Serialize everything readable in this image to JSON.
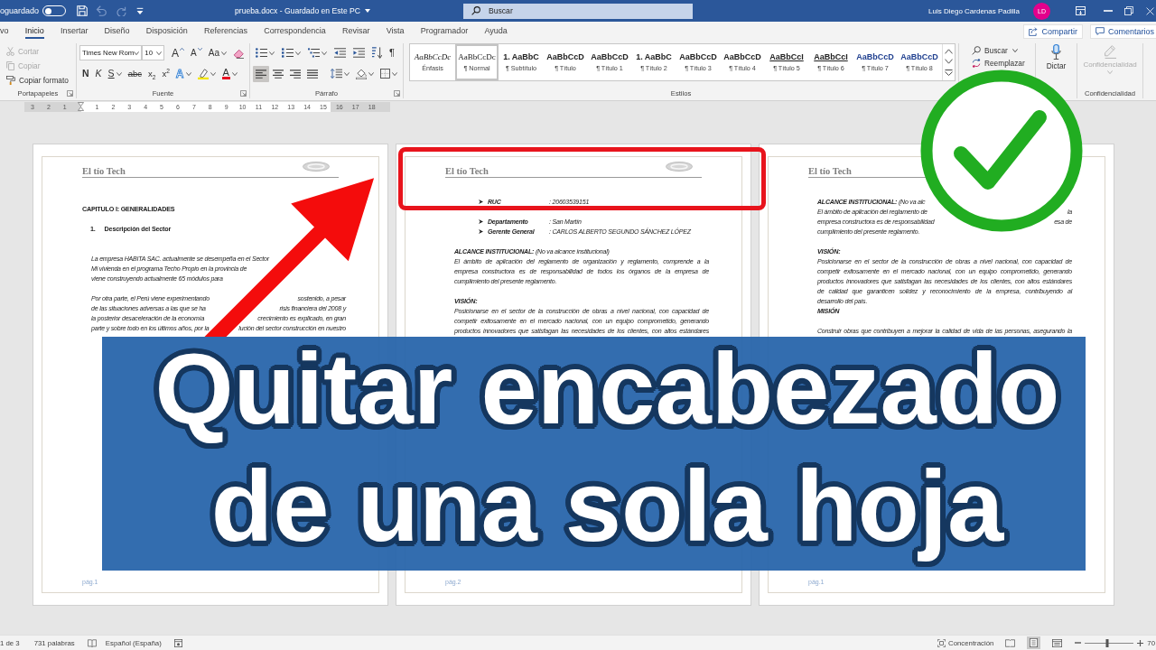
{
  "title_bar": {
    "autosave_label": "oguardado",
    "autosave_on": false,
    "quick_access": [
      {
        "kind": "save",
        "disabled": false
      },
      {
        "kind": "undo",
        "disabled": true
      },
      {
        "kind": "redo",
        "disabled": true
      },
      {
        "kind": "customize",
        "disabled": false
      }
    ],
    "document_title": "prueba.docx - Guardado en Este PC",
    "search": {
      "placeholder": "Buscar"
    },
    "user_name": "Luis Diego Cardenas Padilla",
    "avatar_initials": "LD"
  },
  "tabs": [
    {
      "label": "vo",
      "selected": false
    },
    {
      "label": "Inicio",
      "selected": true
    },
    {
      "label": "Insertar",
      "selected": false
    },
    {
      "label": "Diseño",
      "selected": false
    },
    {
      "label": "Disposición",
      "selected": false
    },
    {
      "label": "Referencias",
      "selected": false
    },
    {
      "label": "Correspondencia",
      "selected": false
    },
    {
      "label": "Revisar",
      "selected": false
    },
    {
      "label": "Vista",
      "selected": false
    },
    {
      "label": "Programador",
      "selected": false
    },
    {
      "label": "Ayuda",
      "selected": false
    }
  ],
  "share_button": {
    "label": "Compartir"
  },
  "comments_button": {
    "label": "Comentarios"
  },
  "ribbon": [
    {
      "kind": "clipboard",
      "label": "Portapapeles",
      "commands": [
        {
          "kind": "cut",
          "label": "Cortar",
          "disabled": true
        },
        {
          "kind": "copy",
          "label": "Copiar",
          "disabled": true
        },
        {
          "kind": "format_painter",
          "label": "Copiar formato",
          "disabled": false
        }
      ]
    },
    {
      "kind": "font",
      "label": "Fuente",
      "font_name": "Times New Rom",
      "font_size": "10",
      "top_tools": [
        {
          "kind": "grow",
          "text": "A"
        },
        {
          "kind": "shrink",
          "text": "A"
        },
        {
          "kind": "case",
          "text": "Aa",
          "menu": true
        },
        {
          "kind": "clear"
        }
      ],
      "bottom_tools": [
        {
          "kind": "bold",
          "text": "N"
        },
        {
          "kind": "italic",
          "text": "K"
        },
        {
          "kind": "underline",
          "text": "S",
          "menu": true
        },
        {
          "kind": "strike",
          "text": "abc"
        },
        {
          "kind": "subscript",
          "text": "x$_{2}$"
        },
        {
          "kind": "superscript",
          "text": "x$^{2}$"
        },
        {
          "kind": "effects",
          "text": "A",
          "menu": true
        },
        {
          "kind": "highlight",
          "menu": true
        },
        {
          "kind": "font_color",
          "text": "A",
          "menu": true
        }
      ]
    },
    {
      "kind": "paragraph",
      "label": "Párrafo",
      "top_tools": [
        {
          "kind": "bullets",
          "menu": true
        },
        {
          "kind": "numbering",
          "menu": true
        },
        {
          "kind": "multilevel",
          "menu": true
        },
        {
          "kind": "outdent"
        },
        {
          "kind": "indent"
        },
        {
          "kind": "sort"
        },
        {
          "kind": "marks",
          "text": "¶"
        }
      ],
      "alignment": [
        {
          "kind": "align_left",
          "selected": true
        },
        {
          "kind": "align_center",
          "selected": false
        },
        {
          "kind": "align_right",
          "selected": false
        },
        {
          "kind": "justify",
          "selected": false
        }
      ],
      "bottom_tools": [
        {
          "kind": "line_spacing",
          "menu": true
        },
        {
          "kind": "shading",
          "menu": true
        },
        {
          "kind": "borders",
          "menu": true
        }
      ]
    },
    {
      "kind": "styles",
      "label": "Estilos",
      "items": [
        {
          "kind": "emphasis",
          "preview": "AaBbCcDc",
          "name": "Énfasis",
          "selected": false
        },
        {
          "kind": "normal",
          "preview": "AaBbCcDc",
          "name": "¶ Normal",
          "selected": true
        },
        {
          "kind": "heading",
          "preview": "1. AaBbC",
          "name": "¶ Subtítulo",
          "selected": false
        },
        {
          "kind": "heading",
          "preview": "AaBbCcD",
          "name": "¶ Título",
          "selected": false
        },
        {
          "kind": "heading",
          "preview": "AaBbCcD",
          "name": "¶ Título 1",
          "selected": false
        },
        {
          "kind": "heading",
          "preview": "1. AaBbC",
          "name": "¶ Título 2",
          "selected": false
        },
        {
          "kind": "heading",
          "preview": "AaBbCcD",
          "name": "¶ Título 3",
          "selected": false
        },
        {
          "kind": "heading",
          "preview": "AaBbCcD",
          "name": "¶ Título 4",
          "selected": false
        },
        {
          "kind": "underlined",
          "preview": "AaBbCcI",
          "name": "¶ Título 5",
          "selected": false
        },
        {
          "kind": "underlined",
          "preview": "AaBbCcI",
          "name": "¶ Título 6",
          "selected": false
        },
        {
          "kind": "accent",
          "preview": "AaBbCcD",
          "name": "¶ Título 7",
          "selected": false
        },
        {
          "kind": "accent",
          "preview": "AaBbCcD",
          "name": "¶ Título 8",
          "selected": false
        }
      ]
    },
    {
      "kind": "editing",
      "commands": [
        {
          "kind": "find",
          "label": "Buscar",
          "menu": true
        },
        {
          "kind": "replace",
          "label": "Reemplazar"
        }
      ]
    },
    {
      "kind": "voice",
      "command": {
        "label": "Dictar"
      }
    },
    {
      "kind": "sensitivity",
      "label": "Confidencialidad",
      "command": {
        "label": "Confidencialidad",
        "disabled": true,
        "menu": true
      }
    }
  ],
  "ruler": {
    "left_marks": [
      "3",
      "2",
      "1"
    ],
    "marks": [
      "1",
      "2",
      "3",
      "4",
      "5",
      "6",
      "7",
      "8",
      "9",
      "10",
      "11",
      "12",
      "13",
      "14",
      "15",
      "16",
      "17",
      "18"
    ]
  },
  "pages": [
    {
      "header": "El tío Tech",
      "logo": true,
      "blocks": [
        {
          "kind": "heading",
          "text": "CAPITULO I: GENERALIDADES"
        },
        {
          "kind": "blank"
        },
        {
          "kind": "numbered",
          "number": "1.",
          "text": "Descripción del Sector"
        },
        {
          "kind": "blank"
        },
        {
          "kind": "blank"
        },
        {
          "kind": "lines",
          "lines": [
            {
              "left": "La empresa HABITA SAC.  actualmente se desempeña en el Sector"
            },
            {
              "left": "Mi vivienda en el programa Techo Propio en la provincia de"
            },
            {
              "left": "viene construyendo actualmente 65 módulos para"
            }
          ]
        },
        {
          "kind": "blank"
        },
        {
          "kind": "lines",
          "lines": [
            {
              "left": "Por otra parte, el Perú viene experimentando",
              "right": "sostenido, a pesar"
            },
            {
              "left": "de las situaciones adversas a las que se ha",
              "right": "risis financiera del 2008 y"
            },
            {
              "left": "la posterior desaceleración de la economía",
              "right": "crecimiento es explicado, en gran"
            },
            {
              "left": "parte y sobre todo en los últimos años, por la",
              "right": "lución del sector construcción en nuestro"
            }
          ]
        }
      ],
      "footer": "pág.1"
    },
    {
      "header": "El tío Tech",
      "logo": true,
      "blocks": [
        {
          "kind": "bullets",
          "rows": [
            {
              "label": "RUC",
              "value": ": 20603539151"
            },
            {
              "label": "Departamento",
              "value": ": San Martín"
            },
            {
              "label": "Gerente General",
              "value": ": CARLOS ALBERTO SEGUNDO SÁNCHEZ LÓPEZ"
            }
          ]
        },
        {
          "kind": "blank"
        },
        {
          "kind": "mixed",
          "text": "**ALCANCE INSTITUCIONAL:** (No va alcance institucional)"
        },
        {
          "kind": "paragraph",
          "cut": false,
          "lines": [
            "El ámbito de aplicación del reglamento de organización y reglamento, comprende a la",
            "empresa constructora es de responsabilidad de todos los órganos de la empresa de",
            "cumplimiento del presente reglamento."
          ]
        },
        {
          "kind": "blank"
        },
        {
          "kind": "label",
          "text": "VISIÓN:"
        },
        {
          "kind": "paragraph",
          "cut": true,
          "lines": [
            "Posicionarse en el sector de la construcción de obras a nivel nacional, con capacidad de",
            "competir exitosamente en el mercado nacional, con un equipo comprometido, generando",
            "productos innovadores que satisfagan las necesidades de los clientes, con altos estándares"
          ]
        }
      ],
      "footer": "pág.2"
    },
    {
      "header": "El tío Tech",
      "logo": false,
      "blocks": [
        {
          "kind": "lines",
          "lines": [
            {
              "left": "**ALCANCE INSTITUCIONAL:** (No va alc"
            },
            {
              "left": "El ámbito de aplicación del reglamento de",
              "right": "la"
            },
            {
              "left": "empresa constructora es de responsabilidad",
              "right": "esa de"
            },
            {
              "left": "cumplimiento del presente reglamento."
            }
          ]
        },
        {
          "kind": "blank"
        },
        {
          "kind": "label",
          "text": "VISIÓN:"
        },
        {
          "kind": "paragraph",
          "cut": false,
          "lines": [
            "Posicionarse en el sector de la construcción de obras a nivel nacional, con capacidad de",
            "competir exitosamente en el mercado nacional, con un equipo comprometido, generando",
            "productos innovadores que satisfagan las necesidades de los clientes, con altos estándares",
            "de calidad que garanticen solidez y reconocimiento de la empresa, contribuyendo al",
            "desarrollo del país."
          ]
        },
        {
          "kind": "label",
          "text": "MISIÓN"
        },
        {
          "kind": "blank"
        },
        {
          "kind": "paragraph",
          "cut": true,
          "lines": [
            "Construir obras que contribuyen a mejorar la calidad de vida de las personas, asegurando la"
          ]
        }
      ],
      "footer": "pág.1"
    }
  ],
  "status_bar": {
    "page": "1 de 3",
    "words": "731 palabras",
    "language": "Español (España)",
    "focus": "Concentración",
    "views": [
      {
        "kind": "read",
        "selected": false
      },
      {
        "kind": "print",
        "selected": true
      },
      {
        "kind": "web",
        "selected": false
      }
    ],
    "zoom": {
      "level": 0.45,
      "reading": "70"
    }
  },
  "thumbnail_overlay": {
    "title_lines": [
      "Quitar encabezado",
      "de una sola hoja"
    ]
  }
}
